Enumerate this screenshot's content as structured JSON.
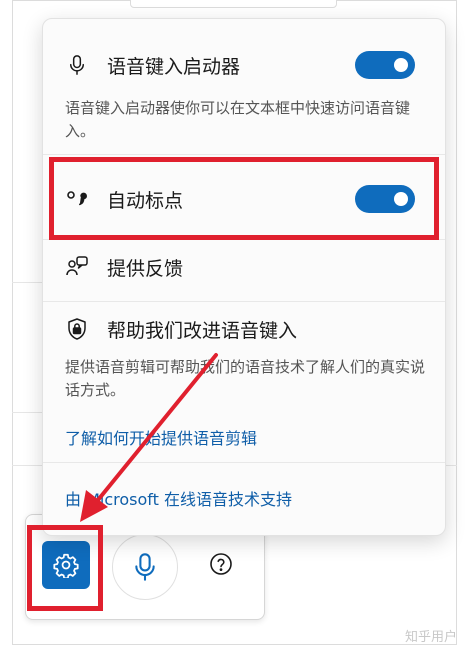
{
  "panel": {
    "launcher": {
      "label": "语音键入启动器",
      "icon": "microphone-icon",
      "enabled": true,
      "description": "语音键入启动器使你可以在文本框中快速访问语音键入。"
    },
    "auto_punctuation": {
      "label": "自动标点",
      "icon": "punctuation-icon",
      "enabled": true
    },
    "feedback": {
      "label": "提供反馈",
      "icon": "feedback-icon"
    },
    "improve": {
      "label": "帮助我们改进语音键入",
      "icon": "shield-lock-icon",
      "description": "提供语音剪辑可帮助我们的语音技术了解人们的真实说话方式。",
      "link": "了解如何开始提供语音剪辑"
    },
    "footer": "由 Microsoft 在线语音技术支持"
  },
  "toolbar": {
    "settings_icon": "gear-icon",
    "mic_icon": "microphone-icon",
    "help_icon": "help-icon"
  },
  "colors": {
    "accent": "#0f6cbd",
    "annotation": "#e0202e"
  },
  "watermark": "知乎用户"
}
